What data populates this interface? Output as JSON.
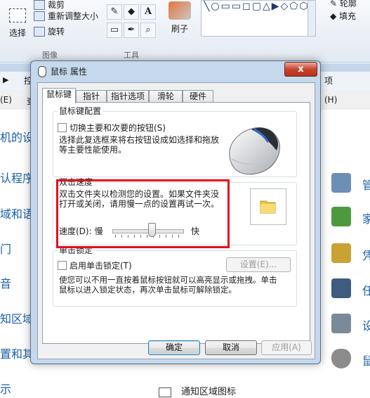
{
  "ribbon": {
    "select_label": "选择",
    "image_ops": [
      "裁剪",
      "重新调整大小",
      "旋转"
    ],
    "group_image": "图像",
    "group_tools": "工具",
    "tool_glyphs": [
      "✎",
      "◆",
      "A",
      "▭",
      "✒",
      "⌕"
    ],
    "brush_label": "刷子",
    "shapes_glyphs": "╲○▭▭◻▢△▶◇⬠⬡◇◁▷⇧⇩✦☆✡◯◯○◌◎",
    "outline_label": "轮廓",
    "fill_label": "填充"
  },
  "control_panel": {
    "addr_fragments": [
      "▶",
      "控",
      "项"
    ],
    "menu_fragments": [
      "(E)",
      "查",
      "(H)"
    ],
    "left_links": [
      "机的设",
      "认程序",
      "域和语",
      "门",
      "音",
      "知区域",
      "置和其",
      "示"
    ],
    "right_items": [
      {
        "label": "管",
        "icon": "admin-tools-icon",
        "color": "#6d8fb5"
      },
      {
        "label": "家",
        "icon": "family-safety-icon",
        "color": "#4d9a3e"
      },
      {
        "label": "凭",
        "icon": "credential-icon",
        "color": "#c8a233"
      },
      {
        "label": "任",
        "icon": "taskbar-icon",
        "color": "#3d5c80"
      },
      {
        "label": "设",
        "icon": "device-manager-icon",
        "color": "#7a8a99"
      },
      {
        "label": "鼠",
        "icon": "mouse-icon",
        "color": "#8c8c8c"
      }
    ],
    "bottom_item": "通知区域图标"
  },
  "dialog": {
    "title": "鼠标 属性",
    "close_glyph": "x",
    "tabs": [
      "鼠标键",
      "指针",
      "指针选项",
      "滑轮",
      "硬件"
    ],
    "active_tab": "鼠标键",
    "button_config": {
      "title": "鼠标键配置",
      "switch_label": "切换主要和次要的按钮(S)",
      "switch_checked": false,
      "description": [
        "选择此复选框来将右按钮设成如选择和拖放",
        "等主要性能使用。"
      ]
    },
    "double_click": {
      "title": "双击速度",
      "description": [
        "双击文件夹以检测您的设置。如果文件夹没",
        "打开或关闭，请用慢一点的设置再试一次。"
      ],
      "speed_label": "速度(D):",
      "slow_label": "慢",
      "fast_label": "快",
      "speed_value_fraction": 0.55
    },
    "click_lock": {
      "title": "单击锁定",
      "enable_label": "启用单击锁定(T)",
      "enable_checked": false,
      "settings_button": "设置(E)...",
      "description": [
        "使您可以不用一直按着鼠标按钮就可以高亮显示或拖拽。单击",
        "鼠标以进入锁定状态，再次单击鼠标可解除锁定。"
      ]
    },
    "buttons": {
      "ok": "确定",
      "cancel": "取消",
      "apply": "应用(A)"
    }
  },
  "annotation": {
    "color": "#e50f1c"
  }
}
